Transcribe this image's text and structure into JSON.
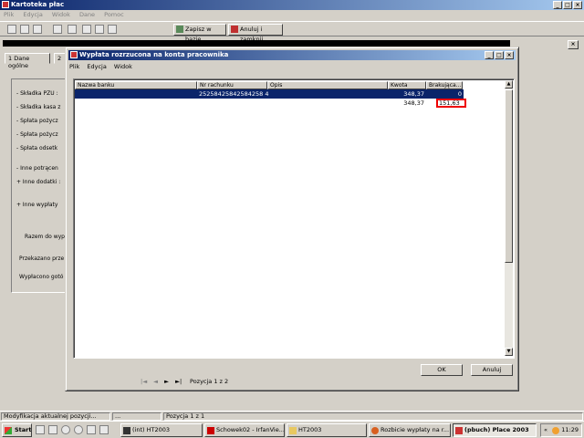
{
  "app": {
    "title": "Kartoteka płac"
  },
  "menu": [
    "Plik",
    "Edycja",
    "Widok",
    "Dane",
    "Pomoc"
  ],
  "toolbar": {
    "save_label": "Zapisz w bazie",
    "cancel_label": "Anuluj i zamknij"
  },
  "tabs": [
    "1 Dane ogólne",
    "2"
  ],
  "left_panel": {
    "items": [
      "- Składka PZU :",
      "- Składka kasa z",
      "- Spłata pożycz",
      "- Spłata pożycz",
      "- Spłata odsetk",
      "- Inne potrącen",
      "+ Inne dodatki :",
      "+ Inne wypłaty",
      "Razem do wyp",
      "Przekazano prze",
      "Wypłacono gotó"
    ]
  },
  "dialog": {
    "title": "Wypłata rozrzucona na konta pracownika",
    "menu": [
      "Plik",
      "Edycja",
      "Widok"
    ],
    "columns": [
      "Nazwa banku",
      "Nr rachunku",
      "Opis",
      "Kwota",
      "Brakująca..."
    ],
    "rows": [
      {
        "bank": "",
        "account": "25258425842584258 4",
        "desc": "",
        "amount": "348,37",
        "missing": "0"
      },
      {
        "bank": "",
        "account": "",
        "desc": "",
        "amount": "348,37",
        "missing": "151,63"
      }
    ],
    "nav": {
      "first": "|◄",
      "prev": "◄",
      "next": "►",
      "last": "►|",
      "position": "Pozycja 1 z 2"
    },
    "ok_label": "OK",
    "cancel_label": "Anuluj"
  },
  "statusbar": {
    "message": "Modyfikacja aktualnej pozycji...",
    "dots": "...",
    "position": "Pozycja 1 z 1"
  },
  "taskbar": {
    "start_label": "Start",
    "tasks": [
      "(int) HT2003",
      "Schowek02 - IrfanVie...",
      "HT2003",
      "Rozbicie wypłaty na r...",
      "(pbuch) Place 2003"
    ],
    "clock": "11:29",
    "tray_glyph": "«"
  }
}
